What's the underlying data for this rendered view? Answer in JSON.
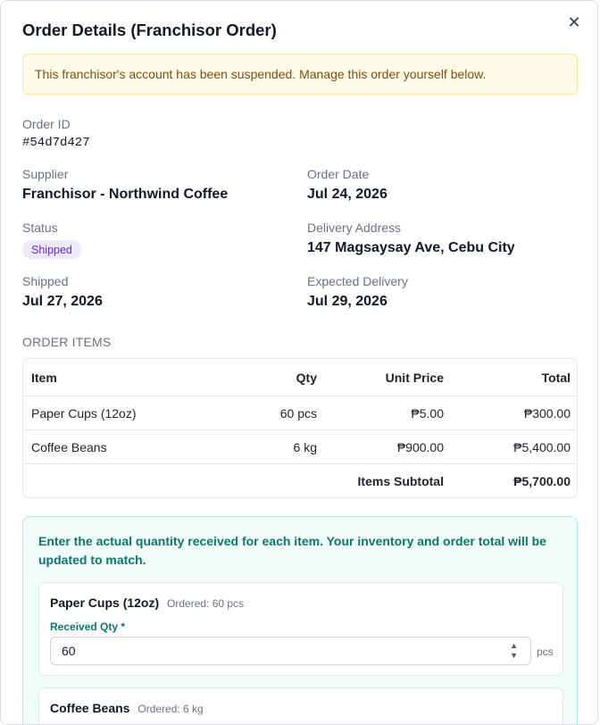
{
  "modal": {
    "title": "Order Details (Franchisor Order)",
    "close_glyph": "✕",
    "banner": "This franchisor's account has been suspended. Manage this order yourself below."
  },
  "order": {
    "order_id_label": "Order ID",
    "order_id": "#54d7d427",
    "supplier_label": "Supplier",
    "supplier": "Franchisor - Northwind Coffee",
    "order_date_label": "Order Date",
    "order_date": "Jul 24, 2026",
    "status_label": "Status",
    "status": "Shipped",
    "delivery_address_label": "Delivery Address",
    "delivery_address": "147 Magsaysay Ave, Cebu City",
    "shipped_label": "Shipped",
    "shipped_date": "Jul 27, 2026",
    "expected_delivery_label": "Expected Delivery",
    "expected_delivery": "Jul 29, 2026"
  },
  "items_section": {
    "heading": "ORDER ITEMS",
    "columns": [
      "Item",
      "Qty",
      "Unit Price",
      "Total"
    ],
    "rows": [
      {
        "item": "Paper Cups (12oz)",
        "qty": "60 pcs",
        "unit_price": "₱5.00",
        "total": "₱300.00"
      },
      {
        "item": "Coffee Beans",
        "qty": "6 kg",
        "unit_price": "₱900.00",
        "total": "₱5,400.00"
      }
    ],
    "subtotal_label": "Items Subtotal",
    "subtotal": "₱5,700.00"
  },
  "receive": {
    "instructions": "Enter the actual quantity received for each item. Your inventory and order total will be updated to match.",
    "items": [
      {
        "name": "Paper Cups (12oz)",
        "ordered": "Ordered: 60 pcs",
        "qty_label": "Received Qty *",
        "value": "60",
        "unit": "pcs"
      },
      {
        "name": "Coffee Beans",
        "ordered": "Ordered: 6 kg"
      }
    ]
  },
  "colors": {
    "banner_bg": "#fefce8",
    "banner_text": "#854d0e",
    "status_badge_bg": "#ede9fe",
    "status_badge_text": "#6d28d9",
    "receive_panel_bg": "#f0fdfa",
    "receive_accent": "#0f766e"
  }
}
